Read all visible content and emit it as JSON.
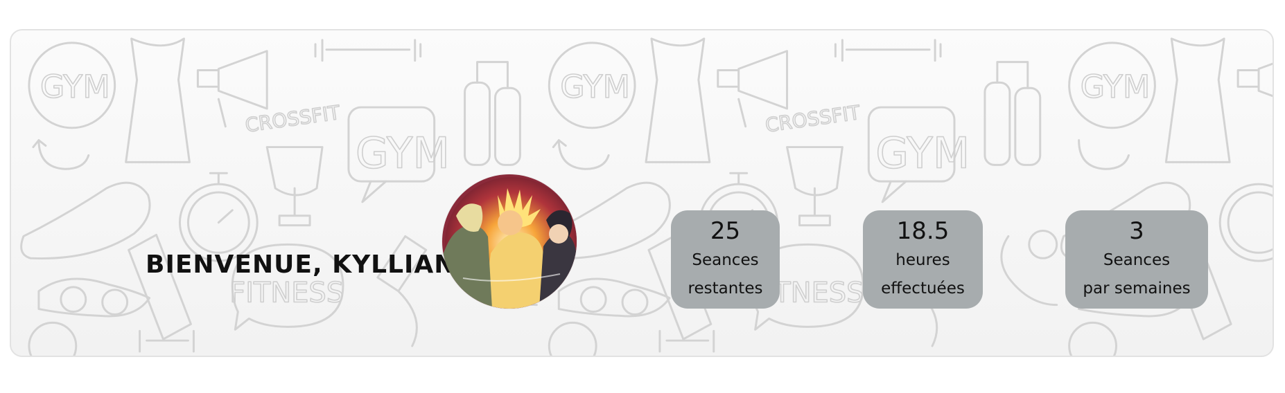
{
  "header": {
    "welcome_text": "BIENVENUE, KYLLIAN"
  },
  "avatar": {
    "alt": "Avatar"
  },
  "background": {
    "doodle_words": [
      "GYM",
      "CROSSFIT",
      "GYM",
      "FITNESS",
      "GYM",
      "CROSSFIT",
      "GYM",
      "FITNESS",
      "GYM"
    ]
  },
  "stats": [
    {
      "value": "25",
      "label_line1": "Seances",
      "label_line2": "restantes"
    },
    {
      "value": "18.5",
      "label_line1": "heures",
      "label_line2": "effectuées"
    },
    {
      "value": "3",
      "label_line1": "Seances",
      "label_line2": "par semaines"
    }
  ],
  "colors": {
    "stat_box": "#a7acae",
    "banner_border": "#e2e2e2",
    "doodle_stroke": "#d3d3d3",
    "text": "#111111"
  }
}
